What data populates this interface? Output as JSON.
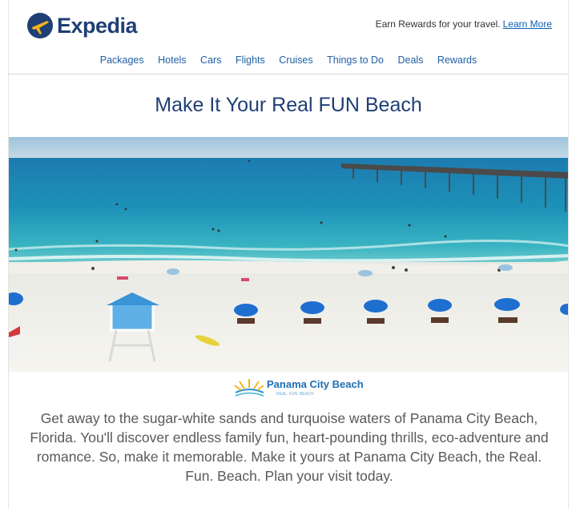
{
  "header": {
    "brand": "Expedia",
    "rewards_text": "Earn Rewards for your travel.",
    "learn_more": "Learn More"
  },
  "nav": [
    "Packages",
    "Hotels",
    "Cars",
    "Flights",
    "Cruises",
    "Things to Do",
    "Deals",
    "Rewards"
  ],
  "headline": "Make It Your Real FUN Beach",
  "logo": {
    "name": "Panama City Beach",
    "tagline": "REAL. FUN. BEACH."
  },
  "body": "Get away to the sugar-white sands and turquoise waters of Panama City Beach, Florida. You'll discover endless family fun, heart-pounding thrills, eco-adventure and romance. So, make it memorable. Make it yours at Panama City Beach, the Real. Fun. Beach. Plan your visit today.",
  "colors": {
    "brand_navy": "#1f3f75",
    "link_blue": "#1f5fa6",
    "logo_yellow": "#f5b31b"
  }
}
